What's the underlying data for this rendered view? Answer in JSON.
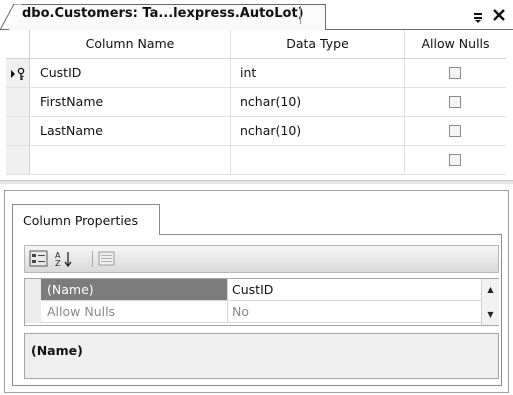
{
  "document_tab": {
    "title": "dbo.Customers: Ta...lexpress.AutoLot)",
    "pin_glyph": "⊕",
    "close_glyph": "×"
  },
  "grid": {
    "headers": {
      "column_name": "Column Name",
      "data_type": "Data Type",
      "allow_nulls": "Allow Nulls"
    },
    "rows": [
      {
        "name": "CustID",
        "type": "int",
        "allow_nulls": false,
        "primary_key": true,
        "current": true
      },
      {
        "name": "FirstName",
        "type": "nchar(10)",
        "allow_nulls": false,
        "primary_key": false,
        "current": false
      },
      {
        "name": "LastName",
        "type": "nchar(10)",
        "allow_nulls": false,
        "primary_key": false,
        "current": false
      },
      {
        "name": "",
        "type": "",
        "allow_nulls": false,
        "primary_key": false,
        "current": false
      }
    ]
  },
  "properties": {
    "tab_label": "Column Properties",
    "toolbar": {
      "categorized_icon": "categorized-icon",
      "alphabetical_icon": "sort-az-icon",
      "property_pages_icon": "property-pages-icon"
    },
    "rows": [
      {
        "name": "(Name)",
        "value": "CustID",
        "selected": true
      },
      {
        "name": "Allow Nulls",
        "value": "No",
        "selected": false
      }
    ],
    "description_title": "(Name)"
  },
  "colors": {
    "selected_property_bg": "#7c7c7c",
    "grid_line": "#e1e1e1",
    "toolbar_gradient_top": "#f6f6f6",
    "toolbar_gradient_bottom": "#d9d9d9"
  }
}
